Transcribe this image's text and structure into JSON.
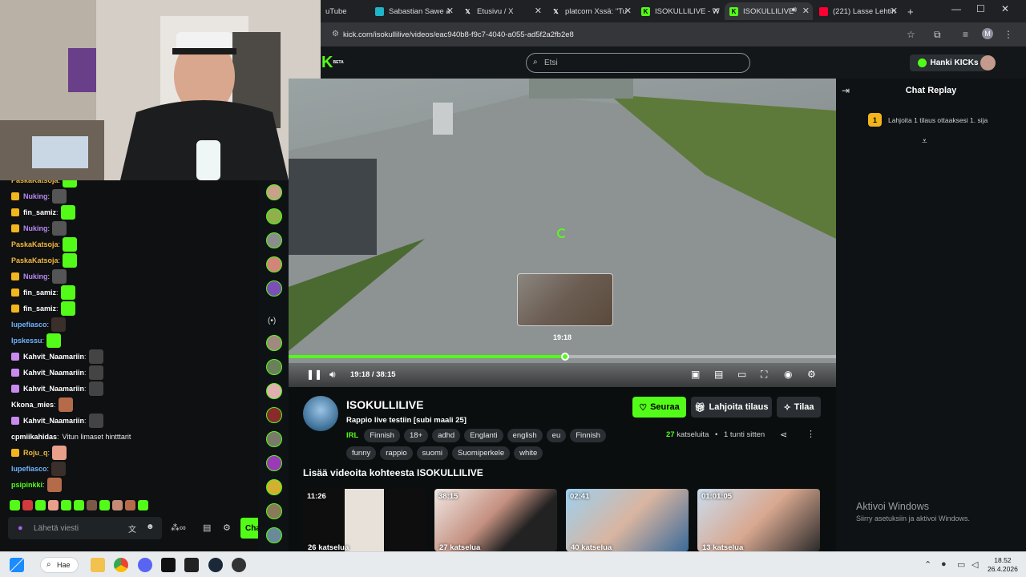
{
  "browser": {
    "tabs": [
      {
        "label": "uTube",
        "favicon": "youtube-favicon",
        "active": false
      },
      {
        "label": "Sabastian Sawe a",
        "favicon": "generic-favicon",
        "active": false
      },
      {
        "label": "Etusivu / X",
        "favicon": "x-favicon",
        "active": false
      },
      {
        "label": "platcorn Xssä: \"Tu",
        "favicon": "x-favicon",
        "active": false
      },
      {
        "label": "ISOKULLILIVE - W",
        "favicon": "kick-favicon",
        "active": false
      },
      {
        "label": "ISOKULLILIVE",
        "favicon": "kick-favicon",
        "active": true
      },
      {
        "label": "(221) Lasse Lehtin",
        "favicon": "youtube-favicon",
        "active": false
      }
    ],
    "new_tab": "+",
    "url": "kick.com/isokullilive/videos/eac940b8-f9c7-4040-a055-ad5f2a2fb2e8",
    "profile_initial": "M"
  },
  "kick": {
    "logo": "K",
    "logo_badge": "BETA",
    "search_placeholder": "Etsi",
    "get_kicks": "Hanki KICKs"
  },
  "left_chat": {
    "lines": [
      {
        "name": "PaskaKatsoja",
        "color": "#f0b93d",
        "badge": null,
        "emote": "#53fc18",
        "text": ""
      },
      {
        "name": "Nuking",
        "color": "#b889f5",
        "badge": "#f2b51d",
        "emote": "#555",
        "text": ""
      },
      {
        "name": "fin_samiz",
        "color": "#ffffff",
        "badge": "#f2b51d",
        "emote": "#53fc18",
        "text": ""
      },
      {
        "name": "Nuking",
        "color": "#b889f5",
        "badge": "#f2b51d",
        "emote": "#555",
        "text": ""
      },
      {
        "name": "PaskaKatsoja",
        "color": "#f0b93d",
        "badge": null,
        "emote": "#53fc18",
        "text": ""
      },
      {
        "name": "PaskaKatsoja",
        "color": "#f0b93d",
        "badge": null,
        "emote": "#53fc18",
        "text": ""
      },
      {
        "name": "Nuking",
        "color": "#b889f5",
        "badge": "#f2b51d",
        "emote": "#555",
        "text": ""
      },
      {
        "name": "fin_samiz",
        "color": "#ffffff",
        "badge": "#f2b51d",
        "emote": "#53fc18",
        "text": ""
      },
      {
        "name": "fin_samiz",
        "color": "#ffffff",
        "badge": "#f2b51d",
        "emote": "#53fc18",
        "text": ""
      },
      {
        "name": "lupefiasco",
        "color": "#6fb5ff",
        "badge": null,
        "emote": "#3a2f2a",
        "text": ""
      },
      {
        "name": "Ipskessu",
        "color": "#6fb5ff",
        "badge": null,
        "emote": "#53fc18",
        "text": ""
      },
      {
        "name": "Kahvit_Naamariin",
        "color": "#ffffff",
        "badge": "#c98af0",
        "emote": "#444",
        "text": ""
      },
      {
        "name": "Kahvit_Naamariin",
        "color": "#ffffff",
        "badge": "#c98af0",
        "emote": "#444",
        "text": ""
      },
      {
        "name": "Kahvit_Naamariin",
        "color": "#ffffff",
        "badge": "#c98af0",
        "emote": "#444",
        "text": ""
      },
      {
        "name": "Kkona_mies",
        "color": "#ffffff",
        "badge": null,
        "emote": "#b56b4a",
        "text": ""
      },
      {
        "name": "Kahvit_Naamariin",
        "color": "#ffffff",
        "badge": "#c98af0",
        "emote": "#444",
        "text": ""
      },
      {
        "name": "cpmiikahidas",
        "color": "#ffffff",
        "badge": null,
        "emote": null,
        "text": "Vitun limaset hintttarit"
      },
      {
        "name": "Roju_q",
        "color": "#f0b93d",
        "badge": "#f2b51d",
        "emote": "#e8a08a",
        "text": ""
      },
      {
        "name": "lupefiasco",
        "color": "#6fb5ff",
        "badge": null,
        "emote": "#3a2f2a",
        "text": ""
      },
      {
        "name": "psipinkki",
        "color": "#53fc18",
        "badge": null,
        "emote": "#b56b4a",
        "text": ""
      }
    ],
    "input_placeholder": "Lähetä viesti",
    "chat_button": "Cha"
  },
  "player": {
    "preview_time": "19:18",
    "time": "19:18 / 38:15",
    "progress": 0.505
  },
  "channel": {
    "name": "ISOKULLILIVE",
    "stream_title": "Rappio live testiin [subi maali 25]",
    "category": "IRL",
    "tags": [
      "Finnish",
      "18+",
      "adhd",
      "Englanti",
      "english",
      "eu",
      "Finnish",
      "funny",
      "rappio",
      "suomi",
      "Suomiperkele",
      "white"
    ],
    "follow": "Seuraa",
    "gift_sub": "Lahjoita tilaus",
    "subscribe": "Tilaa",
    "viewers": "27",
    "viewers_label": "katseluita",
    "ago": "1 tunti sitten",
    "more_heading": "Lisää videoita kohteesta ISOKULLILIVE",
    "videos": [
      {
        "duration": "11:26",
        "views": "26 katselua"
      },
      {
        "duration": "38:15",
        "views": "27 katselua"
      },
      {
        "duration": "02:41",
        "views": "40 katselua"
      },
      {
        "duration": "01:01:05",
        "views": "13 katselua"
      }
    ]
  },
  "replay": {
    "title": "Chat Replay",
    "gift_rank": "1",
    "gift_text": "Lahjoita 1 tilaus ottaaksesi 1. sija"
  },
  "windows": {
    "activate_title": "Aktivoi Windows",
    "activate_sub": "Siirry asetuksiin ja aktivoi Windows.",
    "search": "Hae",
    "time": "18.52",
    "date": "26.4.2026"
  },
  "colors": {
    "accent": "#53fc18",
    "bg": "#0b0e0f"
  }
}
